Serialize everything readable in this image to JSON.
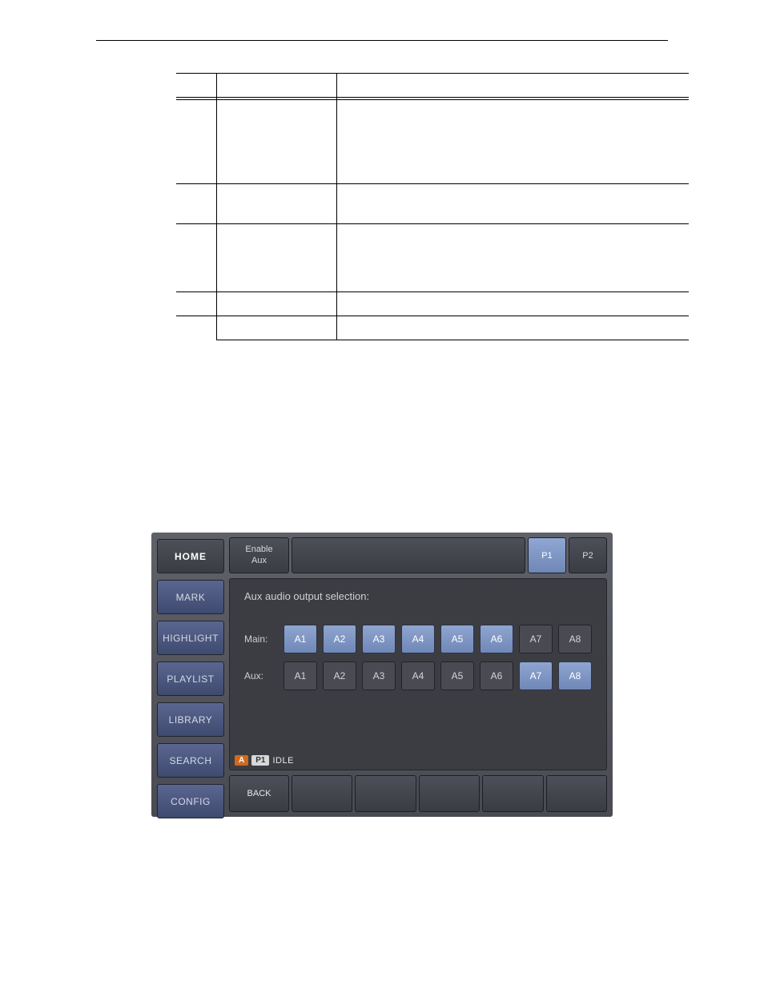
{
  "sidebar": {
    "home": "HOME",
    "items": [
      "MARK",
      "HIGHLIGHT",
      "PLAYLIST",
      "LIBRARY",
      "SEARCH",
      "CONFIG"
    ]
  },
  "topbar": {
    "enable_aux_line1": "Enable",
    "enable_aux_line2": "Aux",
    "p1": "P1",
    "p2": "P2"
  },
  "panel": {
    "title": "Aux audio output selection:",
    "main_label": "Main:",
    "aux_label": "Aux:",
    "main_channels": [
      {
        "label": "A1",
        "on": true
      },
      {
        "label": "A2",
        "on": true
      },
      {
        "label": "A3",
        "on": true
      },
      {
        "label": "A4",
        "on": true
      },
      {
        "label": "A5",
        "on": true
      },
      {
        "label": "A6",
        "on": true
      },
      {
        "label": "A7",
        "on": false
      },
      {
        "label": "A8",
        "on": false
      }
    ],
    "aux_channels": [
      {
        "label": "A1",
        "on": false
      },
      {
        "label": "A2",
        "on": false
      },
      {
        "label": "A3",
        "on": false
      },
      {
        "label": "A4",
        "on": false
      },
      {
        "label": "A5",
        "on": false
      },
      {
        "label": "A6",
        "on": false
      },
      {
        "label": "A7",
        "on": true
      },
      {
        "label": "A8",
        "on": true
      }
    ]
  },
  "status": {
    "badge_a": "A",
    "badge_p": "P1",
    "text": "IDLE"
  },
  "bottom": {
    "back": "BACK"
  }
}
